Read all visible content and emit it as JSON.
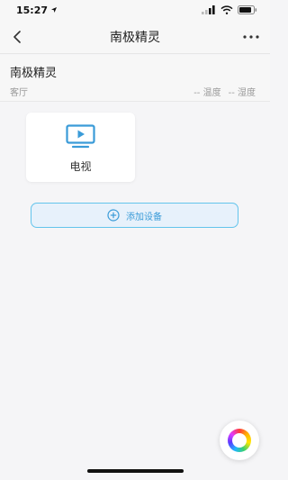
{
  "status_bar": {
    "time": "15:27",
    "location_icon": "location-arrow-icon",
    "signal_icon": "signal-bars-icon",
    "wifi_icon": "wifi-icon",
    "battery_icon": "battery-icon"
  },
  "nav": {
    "title": "南极精灵",
    "back_icon": "chevron-left-icon",
    "more_icon": "more-dots-icon"
  },
  "header": {
    "device_name": "南极精灵",
    "room": "客厅",
    "temperature": "-- 温度",
    "humidity": "-- 湿度"
  },
  "devices": [
    {
      "label": "电视",
      "icon": "tv-icon"
    }
  ],
  "add_device": {
    "label": "添加设备",
    "icon": "plus-circle-icon"
  },
  "fab": {
    "icon": "color-ring-icon"
  },
  "colors": {
    "accent": "#3a9bd8",
    "add_border": "#63c4ec",
    "add_bg": "#e7f1fb",
    "background": "#f5f5f7"
  }
}
